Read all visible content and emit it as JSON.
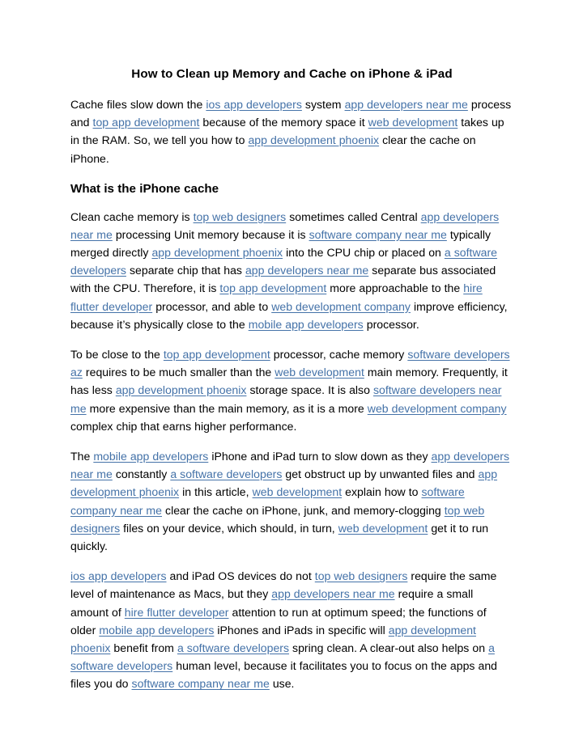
{
  "document": {
    "title": "How to Clean up Memory and Cache on iPhone & iPad",
    "link_color": "#4472a8",
    "text_color": "#000000",
    "background_color": "#ffffff",
    "sections": [
      {
        "id": "intro",
        "heading": null,
        "paragraphs": [
          {
            "id": "p1",
            "runs": [
              {
                "t": "Cache files slow down the ",
                "link": false
              },
              {
                "t": "ios app developers",
                "link": true
              },
              {
                "t": " system ",
                "link": false
              },
              {
                "t": "app developers near me",
                "link": true
              },
              {
                "t": " process and ",
                "link": false
              },
              {
                "t": "top app development",
                "link": true
              },
              {
                "t": " because of the memory space it ",
                "link": false
              },
              {
                "t": "web development",
                "link": true
              },
              {
                "t": " takes up in the RAM. So, we tell you how to ",
                "link": false
              },
              {
                "t": "app development phoenix",
                "link": true
              },
              {
                "t": " clear the cache on iPhone.",
                "link": false
              }
            ]
          }
        ]
      },
      {
        "id": "what-is-the-iphone-cache",
        "heading": "What is the iPhone cache",
        "paragraphs": [
          {
            "id": "p2",
            "runs": [
              {
                "t": "Clean cache memory is ",
                "link": false
              },
              {
                "t": "top web designers",
                "link": true
              },
              {
                "t": " sometimes called Central ",
                "link": false
              },
              {
                "t": "app developers near me",
                "link": true
              },
              {
                "t": " processing Unit memory because it is ",
                "link": false
              },
              {
                "t": "software company near me",
                "link": true
              },
              {
                "t": " typically merged directly ",
                "link": false
              },
              {
                "t": "app development phoenix",
                "link": true
              },
              {
                "t": " into the CPU chip or placed on ",
                "link": false
              },
              {
                "t": "a software developers",
                "link": true
              },
              {
                "t": " separate chip that has ",
                "link": false
              },
              {
                "t": "app developers near me",
                "link": true
              },
              {
                "t": " separate bus associated with the CPU. Therefore, it is ",
                "link": false
              },
              {
                "t": "top app development",
                "link": true
              },
              {
                "t": " more approachable to the ",
                "link": false
              },
              {
                "t": "hire flutter developer",
                "link": true
              },
              {
                "t": " processor, and able to ",
                "link": false
              },
              {
                "t": "web development company",
                "link": true
              },
              {
                "t": " improve efficiency, because it’s physically close to the ",
                "link": false
              },
              {
                "t": "mobile app developers",
                "link": true
              },
              {
                "t": " processor.",
                "link": false
              }
            ]
          },
          {
            "id": "p3",
            "runs": [
              {
                "t": "To be close to the ",
                "link": false
              },
              {
                "t": "top app development",
                "link": true
              },
              {
                "t": " processor, cache memory ",
                "link": false
              },
              {
                "t": "software developers az",
                "link": true
              },
              {
                "t": " requires to be much smaller than the ",
                "link": false
              },
              {
                "t": "web development",
                "link": true
              },
              {
                "t": " main memory. Frequently, it has less ",
                "link": false
              },
              {
                "t": "app development phoenix",
                "link": true
              },
              {
                "t": " storage space. It is also ",
                "link": false
              },
              {
                "t": "software developers near me",
                "link": true
              },
              {
                "t": " more expensive than the main memory, as it is a more ",
                "link": false
              },
              {
                "t": "web development company",
                "link": true
              },
              {
                "t": " complex chip that earns higher performance.",
                "link": false
              }
            ]
          },
          {
            "id": "p4",
            "runs": [
              {
                "t": "The ",
                "link": false
              },
              {
                "t": "mobile app developers",
                "link": true
              },
              {
                "t": " iPhone and iPad turn to slow down as they ",
                "link": false
              },
              {
                "t": "app developers near me",
                "link": true
              },
              {
                "t": " constantly ",
                "link": false
              },
              {
                "t": "a software developers",
                "link": true
              },
              {
                "t": " get obstruct up by unwanted files and ",
                "link": false
              },
              {
                "t": "app development phoenix",
                "link": true
              },
              {
                "t": " in this article, ",
                "link": false
              },
              {
                "t": "web development",
                "link": true
              },
              {
                "t": " explain how to ",
                "link": false
              },
              {
                "t": "software company near me",
                "link": true
              },
              {
                "t": " clear the cache on iPhone, junk, and memory-clogging ",
                "link": false
              },
              {
                "t": "top web designers",
                "link": true
              },
              {
                "t": " files on your device, which should, in turn, ",
                "link": false
              },
              {
                "t": "web development",
                "link": true
              },
              {
                "t": " get it to run quickly.",
                "link": false
              }
            ]
          },
          {
            "id": "p5",
            "runs": [
              {
                "t": "ios app developers",
                "link": true
              },
              {
                "t": " and iPad OS devices do not ",
                "link": false
              },
              {
                "t": "top web designers",
                "link": true
              },
              {
                "t": " require the same level of maintenance as Macs, but they ",
                "link": false
              },
              {
                "t": "app developers near me",
                "link": true
              },
              {
                "t": " require a small amount of ",
                "link": false
              },
              {
                "t": "hire flutter developer",
                "link": true
              },
              {
                "t": " attention to run at optimum speed; the functions of older ",
                "link": false
              },
              {
                "t": "mobile app developers",
                "link": true
              },
              {
                "t": " iPhones and iPads in specific will ",
                "link": false
              },
              {
                "t": "app development phoenix",
                "link": true
              },
              {
                "t": " benefit from ",
                "link": false
              },
              {
                "t": "a software developers",
                "link": true
              },
              {
                "t": " spring clean. A clear-out also helps on ",
                "link": false
              },
              {
                "t": "a software developers",
                "link": true
              },
              {
                "t": " human level, because it facilitates you to focus on the apps and files you do ",
                "link": false
              },
              {
                "t": "software company near me",
                "link": true
              },
              {
                "t": " use.",
                "link": false
              }
            ]
          }
        ]
      }
    ]
  }
}
